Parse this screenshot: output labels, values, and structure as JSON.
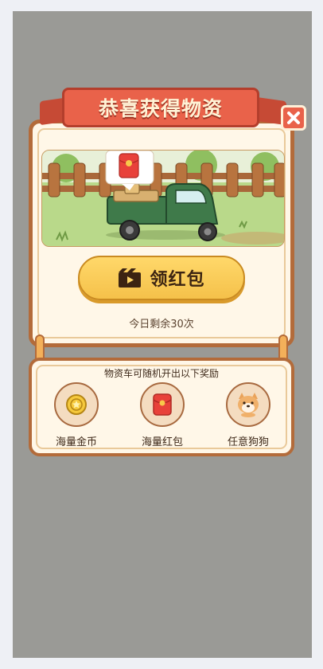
{
  "popup": {
    "title": "恭喜获得物资",
    "claim_button_label": "领红包",
    "remaining_text": "今日剩余30次",
    "icons": {
      "close": "close-icon",
      "play": "video-play-icon",
      "bubble": "red-envelope-icon",
      "truck": "truck-icon"
    }
  },
  "rewards": {
    "title": "物资车可随机开出以下奖励",
    "items": [
      {
        "label": "海量金币",
        "icon": "coin-icon"
      },
      {
        "label": "海量红包",
        "icon": "red-envelope-icon"
      },
      {
        "label": "任意狗狗",
        "icon": "dog-icon"
      }
    ]
  },
  "colors": {
    "ribbon": "#e9624a",
    "button": "#f5c14a",
    "border": "#b36b3a",
    "panel": "#fff7e8"
  }
}
